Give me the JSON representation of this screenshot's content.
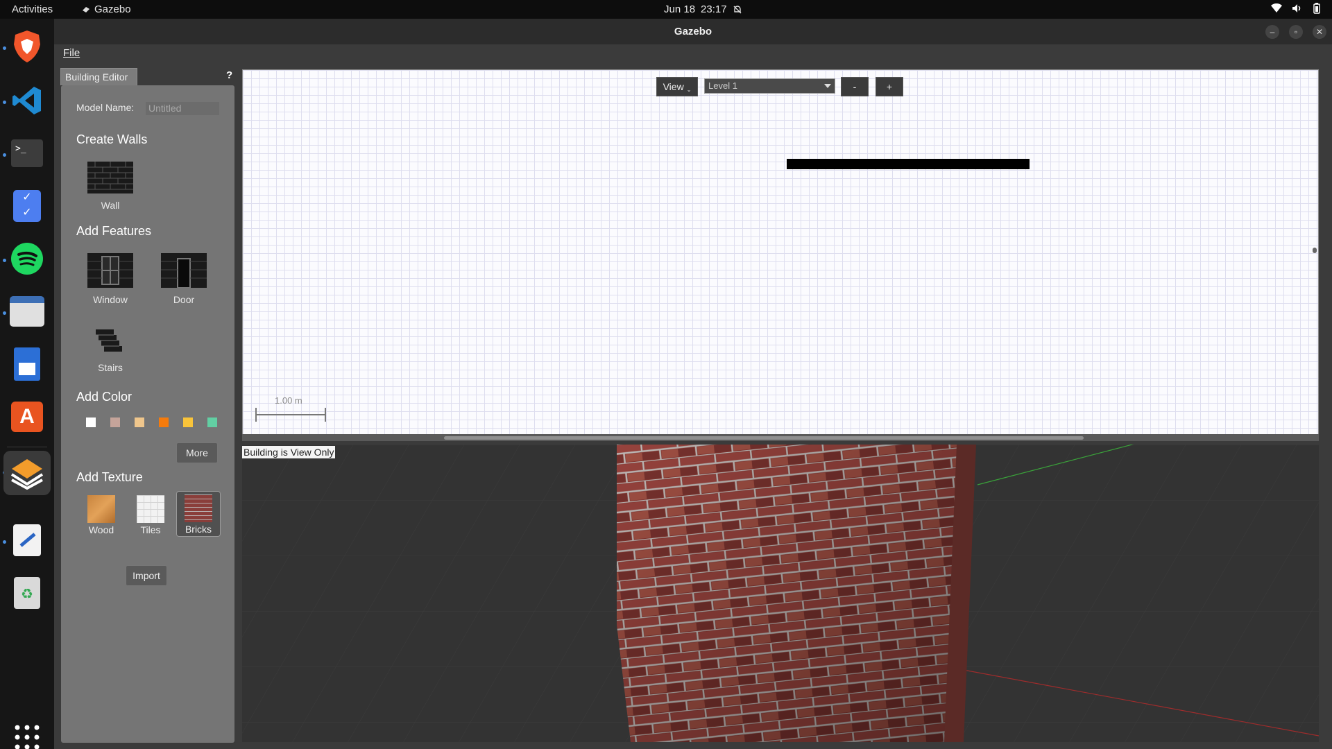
{
  "topbar": {
    "activities": "Activities",
    "app_name": "Gazebo",
    "date": "Jun 18",
    "time": "23:17",
    "icons": [
      "gazebo-small-icon",
      "bell-off-icon",
      "wifi-icon",
      "volume-icon",
      "battery-icon"
    ]
  },
  "dock": {
    "items": [
      "brave-browser-icon",
      "vscode-icon",
      "terminal-icon",
      "tasks-icon",
      "spotify-icon",
      "files-icon",
      "writer-icon",
      "app-center-icon",
      "gazebo-icon",
      "text-editor-icon",
      "trash-icon",
      "show-apps-icon"
    ]
  },
  "window": {
    "title": "Gazebo",
    "menu": {
      "file": "File"
    }
  },
  "building_editor": {
    "tab_label": "Building Editor",
    "help": "?",
    "model_name_label": "Model Name:",
    "model_name_value": "Untitled",
    "create_walls": "Create Walls",
    "wall": "Wall",
    "add_features": "Add Features",
    "window": "Window",
    "door": "Door",
    "stairs": "Stairs",
    "add_color": "Add Color",
    "colors": [
      "#ffffff",
      "#c5a49a",
      "#efc68c",
      "#f57b0c",
      "#f9c43a",
      "#62cfa3"
    ],
    "more": "More",
    "add_texture": "Add Texture",
    "textures": [
      "Wood",
      "Tiles",
      "Bricks"
    ],
    "import": "Import"
  },
  "editor2d": {
    "view": "View",
    "level": "Level 1",
    "minus": "-",
    "plus": "+",
    "scale": "1.00 m"
  },
  "view3d": {
    "status": "Building is View Only"
  }
}
